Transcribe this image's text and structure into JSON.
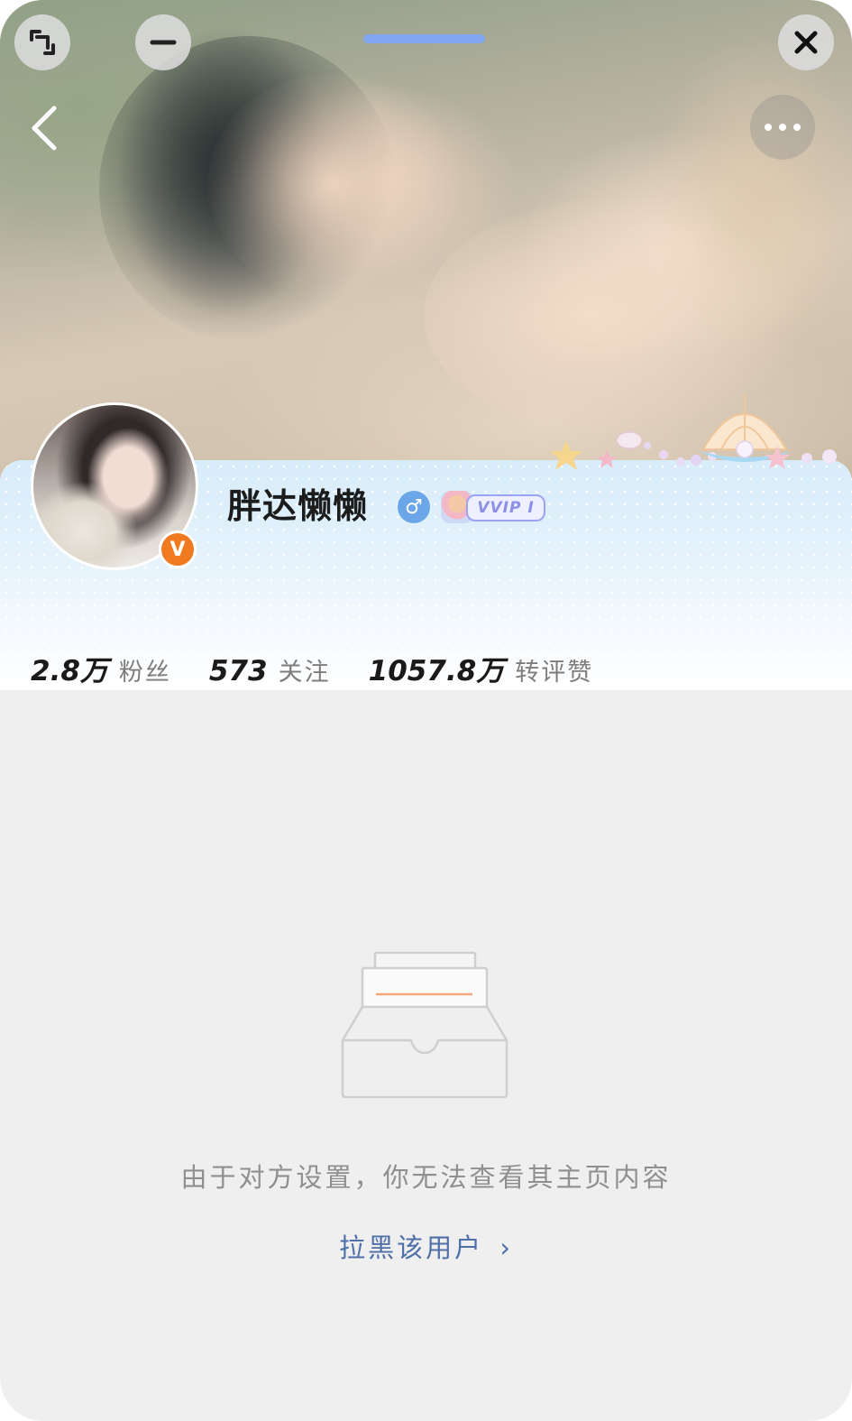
{
  "window": {
    "controls": {
      "collapse_icon": "collapse-window-icon",
      "minimize_icon": "minimize-icon",
      "close_icon": "close-icon"
    },
    "accent_color": "#7fa6ee"
  },
  "header": {
    "back_icon": "chevron-left-icon",
    "more_icon": "more-horizontal-icon"
  },
  "profile": {
    "username": "胖达懒懒",
    "gender_symbol": "♂",
    "verified_badge": "V",
    "vip_label": "VVIP I",
    "colors": {
      "verified": "#f07a20",
      "gender": "#6aa6e8",
      "vip": "#8c8fe6"
    }
  },
  "stats": [
    {
      "value": "2.8万",
      "label": "粉丝"
    },
    {
      "value": "573",
      "label": "关注"
    },
    {
      "value": "1057.8万",
      "label": "转评赞"
    }
  ],
  "empty_state": {
    "icon": "empty-tray-icon",
    "message": "由于对方设置，你无法查看其主页内容",
    "action_label": "拉黑该用户",
    "action_chevron": "›",
    "action_color": "#4f6fa8"
  }
}
